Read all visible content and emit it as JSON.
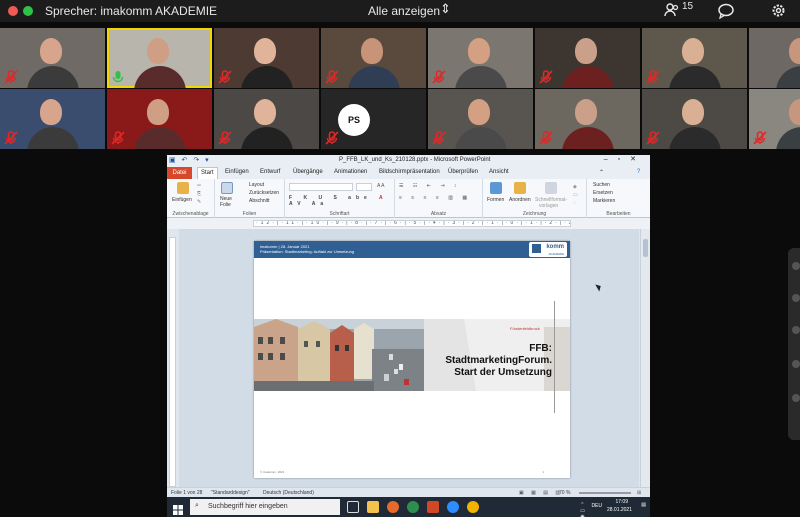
{
  "zoom": {
    "speaker_label": "Sprecher: imakomm AKADEMIE",
    "view_label": "Alle anzeigen",
    "participant_count": "15",
    "icons": [
      "people-icon",
      "chat-icon",
      "gear-icon",
      "mute-icon"
    ],
    "tile_initials": "PS",
    "colors": {
      "close": "#ee5b53",
      "maximize": "#2fc246",
      "mute": "#e02828",
      "active_speaker": "#f2d600"
    }
  },
  "ppt": {
    "window_title": "P_FFB_LK_und_Ks_210128.pptx - Microsoft PowerPoint",
    "tabs": [
      "Datei",
      "Start",
      "Einfügen",
      "Entwurf",
      "Übergänge",
      "Animationen",
      "Bildschirmpräsentation",
      "Überprüfen",
      "Ansicht"
    ],
    "ribbon": {
      "paste": "Einfügen",
      "new_slide_1": "Neue",
      "new_slide_2": "Folie",
      "layout": "Layout",
      "reset": "Zurücksetzen",
      "section": "Abschnitt",
      "shapes": "Formen",
      "arrange": "Anordnen",
      "quick_styles_1": "Schnellformat-",
      "quick_styles_2": "vorlagen",
      "find": "Suchen",
      "replace": "Ersetzen",
      "select": "Markieren",
      "groups": [
        "Zwischenablage",
        "Folien",
        "Schriftart",
        "Absatz",
        "Zeichnung",
        "Bearbeiten"
      ]
    },
    "ruler_text": "·12·|·11·|·10·|·9·|·8·|·7·|·6·|·5·|·4·|·3·|·2·|·1·|·0·|·1·|·2·|·3·|·4·|·5·|·6·|·7·|·8·|·9·|·10·|·11·|·12·",
    "slide": {
      "header_line1": "imakomm  |  28. Januar 2021",
      "header_line2": "Präsentation: Stadtmarketing: Auftakt zur Umsetzung",
      "logo_word": "komm",
      "logo_sub": "AKADEMIE",
      "fb_label": "Fürstenfeldbruck",
      "title_line1": "FFB:",
      "title_line2": "StadtmarketingForum.",
      "title_line3": "Start der Umsetzung",
      "footer": "© imakomm, 2021",
      "number": "1"
    },
    "status": {
      "slide_count": "Folie 1 von 28",
      "theme": "\"Standarddesign\"",
      "language": "Deutsch (Deutschland)",
      "zoom": "70 %"
    },
    "taskbar": {
      "search_placeholder": "Suchbegriff hier eingeben",
      "keyboard": "DEU",
      "time": "17:09",
      "date": "28.01.2021"
    }
  }
}
